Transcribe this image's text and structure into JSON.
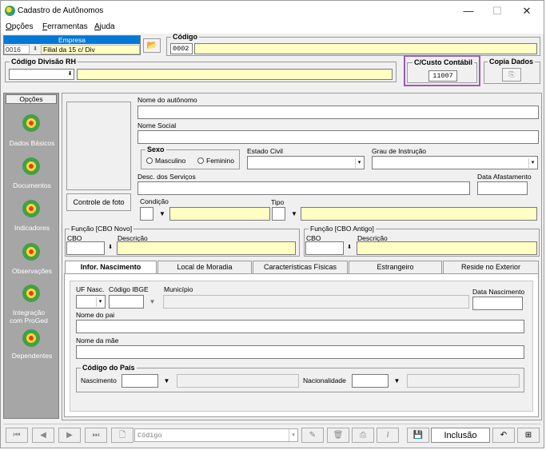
{
  "window": {
    "title": "Cadastro de Autônomos",
    "minimize": "—",
    "maximize": "☐",
    "close": "✕"
  },
  "menu": [
    {
      "label": "Opções",
      "u": "O",
      "rest": "pções"
    },
    {
      "label": "Ferramentas",
      "u": "F",
      "rest": "erramentas"
    },
    {
      "label": "Ajuda",
      "u": "A",
      "rest": "juda"
    }
  ],
  "empresa": {
    "label": "Empresa",
    "code": "0016",
    "value": "Filial da 15  c/ Div"
  },
  "codigo": {
    "label": "Código",
    "value": "0002"
  },
  "divisao": {
    "label": "Código Divisão RH",
    "code": "",
    "desc": ""
  },
  "custo": {
    "label": "C/Custo Contábil",
    "value": "11007"
  },
  "copia": {
    "label": "Copia Dados"
  },
  "sidebar": {
    "header": "Opções",
    "items": [
      "Dados Básicos",
      "Documentos",
      "Indicadores",
      "Observações",
      "Integração com ProGed",
      "Dependentes"
    ]
  },
  "form": {
    "nome_label": "Nome do autônomo",
    "nome_value": "",
    "social_label": "Nome Social",
    "social_value": "",
    "sexo_label": "Sexo",
    "masc_label": "Masculino",
    "fem_label": "Feminino",
    "estado_civil_label": "Estado Civil",
    "grau_label": "Grau de Instrução",
    "desc_serv_label": "Desc. dos Serviços",
    "data_afast_label": "Data Afastamento",
    "foto_button": "Controle de foto",
    "condicao_label": "Condição",
    "tipo_label": "Tipo",
    "cbo_novo_label": "Função [CBO Novo]",
    "cbo_antigo_label": "Função [CBO Antigo]",
    "cbo_label": "CBO",
    "descricao_label": "Descrição"
  },
  "tabs": [
    "Infor. Nascimento",
    "Local de Moradia",
    "Características Físicas",
    "Estrangeiro",
    "Reside no Exterior"
  ],
  "nascimento": {
    "uf_label": "UF Nasc.",
    "ibge_label": "Código IBGE",
    "municipio_label": "Município",
    "data_label": "Data Nascimento",
    "pai_label": "Nome do pai",
    "mae_label": "Nome da mãe",
    "pais_label": "Código do País",
    "nasc_label": "Nascimento",
    "nacionalidade_label": "Nacionalidade"
  },
  "statusbar": {
    "search_placeholder": "Código",
    "mode": "Inclusão",
    "nav": [
      "⏮",
      "◀",
      "▶",
      "⏭"
    ]
  }
}
